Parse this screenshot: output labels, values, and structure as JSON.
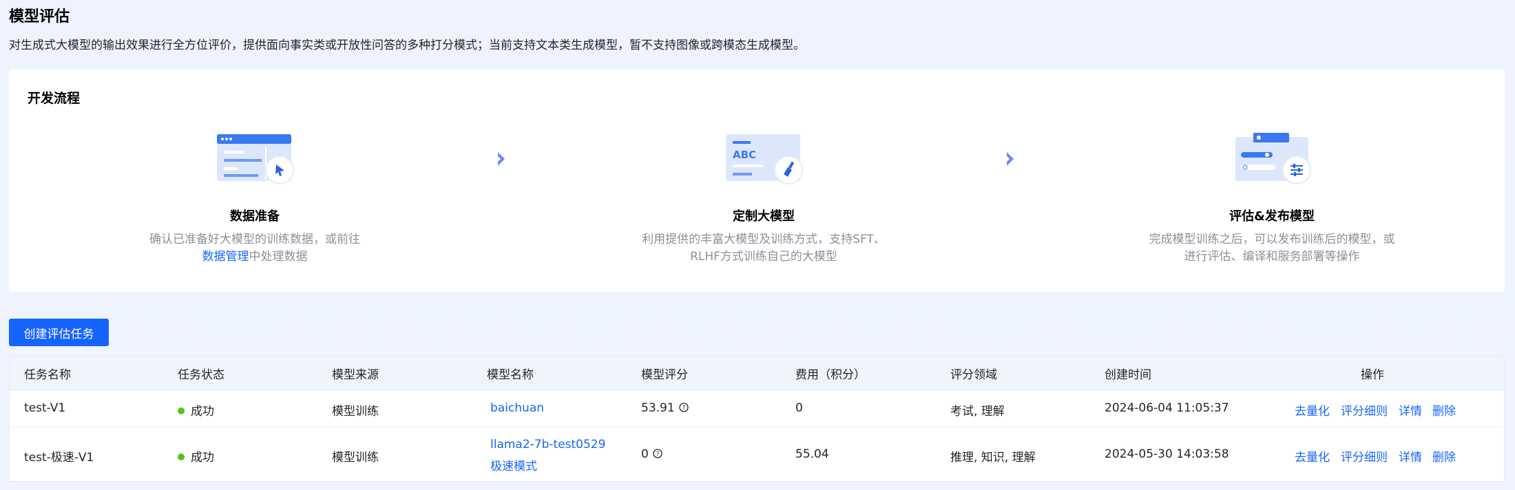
{
  "page": {
    "title": "模型评估",
    "description": "对生成式大模型的输出效果进行全方位评价，提供面向事实类或开放性问答的多种打分模式；当前支持文本类生成模型，暂不支持图像或跨模态生成模型。"
  },
  "flow": {
    "title": "开发流程",
    "steps": [
      {
        "name": "数据准备",
        "desc_line1": "确认已准备好大模型的训练数据，或前往",
        "link": "数据管理",
        "desc_line2_after_link": "中处理数据",
        "icon": "data-window-icon"
      },
      {
        "name": "定制大模型",
        "desc_line1": "利用提供的丰富大模型及训练方式，支持SFT、",
        "desc_line2": "RLHF方式训练自己的大模型",
        "icon": "abc-brush-icon"
      },
      {
        "name": "评估&发布模型",
        "desc_line1": "完成模型训练之后，可以发布训练后的模型，或",
        "desc_line2": "进行评估、编译和服务部署等操作",
        "icon": "settings-panel-icon"
      }
    ]
  },
  "create_button": "创建评估任务",
  "table": {
    "headers": [
      "任务名称",
      "任务状态",
      "模型来源",
      "模型名称",
      "模型评分",
      "费用（积分）",
      "评分领域",
      "创建时间",
      "操作"
    ],
    "rows": [
      {
        "name": "test-V1",
        "status": "成功",
        "source": "模型训练",
        "model": "baichuan",
        "model_line2": "",
        "score": "53.91",
        "cost": "0",
        "domain": "考试, 理解",
        "created": "2024-06-04 11:05:37"
      },
      {
        "name": "test-极速-V1",
        "status": "成功",
        "source": "模型训练",
        "model": "llama2-7b-test0529",
        "model_line2": "极速模式",
        "score": "0",
        "cost": "55.04",
        "domain": "推理, 知识, 理解",
        "created": "2024-05-30 14:03:58"
      }
    ],
    "actions": [
      "去量化",
      "评分细则",
      "详情",
      "删除"
    ]
  },
  "colors": {
    "primary": "#1664ff",
    "success": "#52c41a",
    "muted": "#8a9099"
  }
}
